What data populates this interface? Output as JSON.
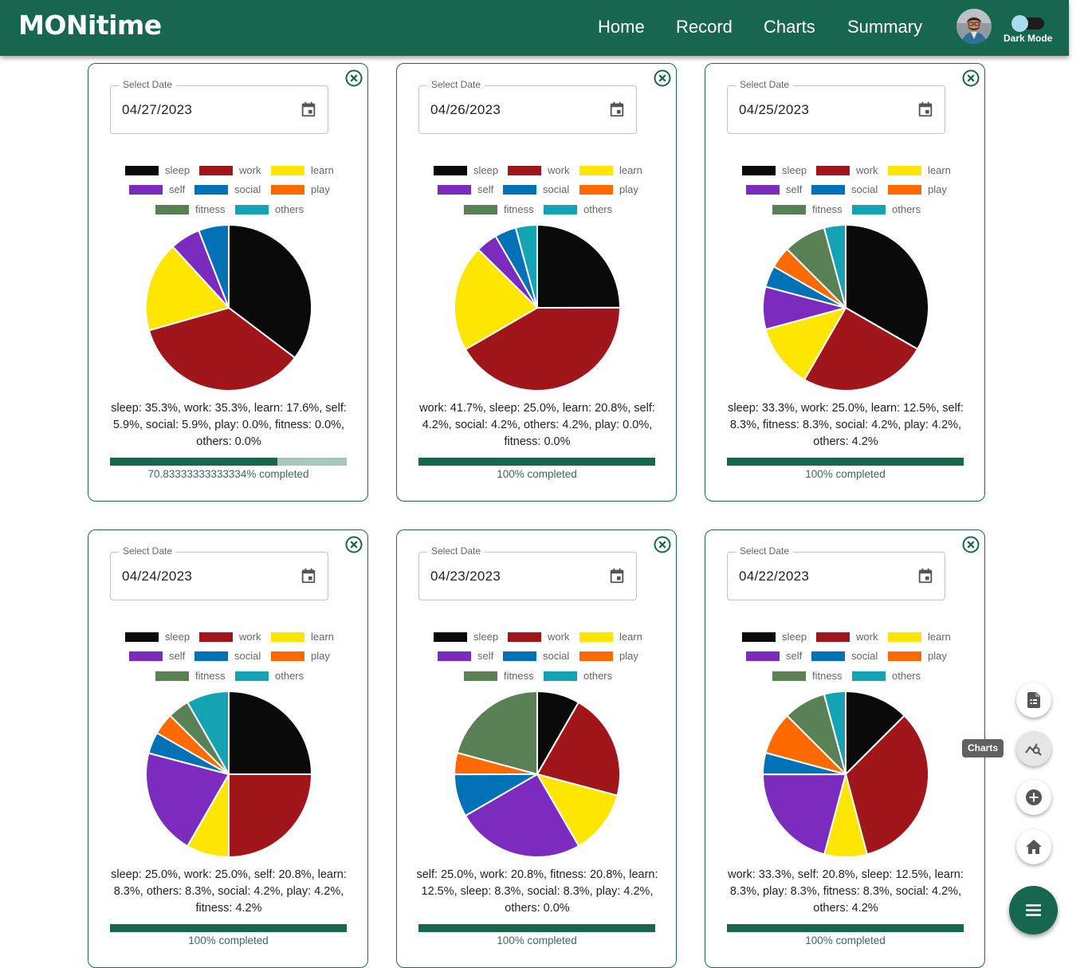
{
  "app": {
    "title": "MONitime"
  },
  "nav": {
    "items": [
      "Home",
      "Record",
      "Charts",
      "Summary"
    ]
  },
  "header": {
    "avatar": "user-avatar",
    "dark_mode_label": "Dark Mode",
    "dark_mode_on": false
  },
  "categories": [
    {
      "name": "sleep",
      "color": "#0a0a0a"
    },
    {
      "name": "work",
      "color": "#a0161b"
    },
    {
      "name": "learn",
      "color": "#ffe600"
    },
    {
      "name": "self",
      "color": "#7b2cbf"
    },
    {
      "name": "social",
      "color": "#0072b5"
    },
    {
      "name": "play",
      "color": "#ff6a00"
    },
    {
      "name": "fitness",
      "color": "#5a8156"
    },
    {
      "name": "others",
      "color": "#13a3b3"
    }
  ],
  "cards": [
    {
      "date_label": "Select Date",
      "date": "04/27/2023",
      "slices": {
        "sleep": 35.3,
        "work": 35.3,
        "learn": 17.6,
        "self": 5.9,
        "social": 5.9,
        "play": 0,
        "fitness": 0,
        "others": 0
      },
      "summary": "sleep: 35.3%, work: 35.3%, learn: 17.6%, self: 5.9%, social: 5.9%, play: 0.0%, fitness: 0.0%, others: 0.0%",
      "progress": 70.83333333333334,
      "progress_label": "70.83333333333334% completed"
    },
    {
      "date_label": "Select Date",
      "date": "04/26/2023",
      "slices": {
        "sleep": 25.0,
        "work": 41.7,
        "learn": 20.8,
        "self": 4.2,
        "social": 4.2,
        "play": 0,
        "fitness": 0,
        "others": 4.2
      },
      "summary": "work: 41.7%, sleep: 25.0%, learn: 20.8%, self: 4.2%, social: 4.2%, others: 4.2%, play: 0.0%, fitness: 0.0%",
      "progress": 100,
      "progress_label": "100% completed"
    },
    {
      "date_label": "Select Date",
      "date": "04/25/2023",
      "slices": {
        "sleep": 33.3,
        "work": 25.0,
        "learn": 12.5,
        "self": 8.3,
        "social": 4.2,
        "play": 4.2,
        "fitness": 8.3,
        "others": 4.2
      },
      "summary": "sleep: 33.3%, work: 25.0%, learn: 12.5%, self: 8.3%, fitness: 8.3%, social: 4.2%, play: 4.2%, others: 4.2%",
      "progress": 100,
      "progress_label": "100% completed"
    },
    {
      "date_label": "Select Date",
      "date": "04/24/2023",
      "slices": {
        "sleep": 25.0,
        "work": 25.0,
        "learn": 8.3,
        "self": 20.8,
        "social": 4.2,
        "play": 4.2,
        "fitness": 4.2,
        "others": 8.3
      },
      "summary": "sleep: 25.0%, work: 25.0%, self: 20.8%, learn: 8.3%, others: 8.3%, social: 4.2%, play: 4.2%, fitness: 4.2%",
      "progress": 100,
      "progress_label": "100% completed"
    },
    {
      "date_label": "Select Date",
      "date": "04/23/2023",
      "slices": {
        "sleep": 8.3,
        "work": 20.8,
        "learn": 12.5,
        "self": 25.0,
        "social": 8.3,
        "play": 4.2,
        "fitness": 20.8,
        "others": 0
      },
      "summary": "self: 25.0%, work: 20.8%, fitness: 20.8%, learn: 12.5%, sleep: 8.3%, social: 8.3%, play: 4.2%, others: 0.0%",
      "progress": 100,
      "progress_label": "100% completed"
    },
    {
      "date_label": "Select Date",
      "date": "04/22/2023",
      "slices": {
        "sleep": 12.5,
        "work": 33.3,
        "learn": 8.3,
        "self": 20.8,
        "social": 4.2,
        "play": 8.3,
        "fitness": 8.3,
        "others": 4.2
      },
      "summary": "work: 33.3%, self: 20.8%, sleep: 12.5%, learn: 8.3%, play: 8.3%, fitness: 8.3%, social: 4.2%, others: 4.2%",
      "progress": 100,
      "progress_label": "100% completed"
    }
  ],
  "fab": {
    "actions": [
      {
        "name": "summary-icon"
      },
      {
        "name": "charts-icon",
        "tooltip": "Charts"
      },
      {
        "name": "add-icon"
      },
      {
        "name": "home-icon"
      }
    ],
    "main": "menu-icon"
  }
}
